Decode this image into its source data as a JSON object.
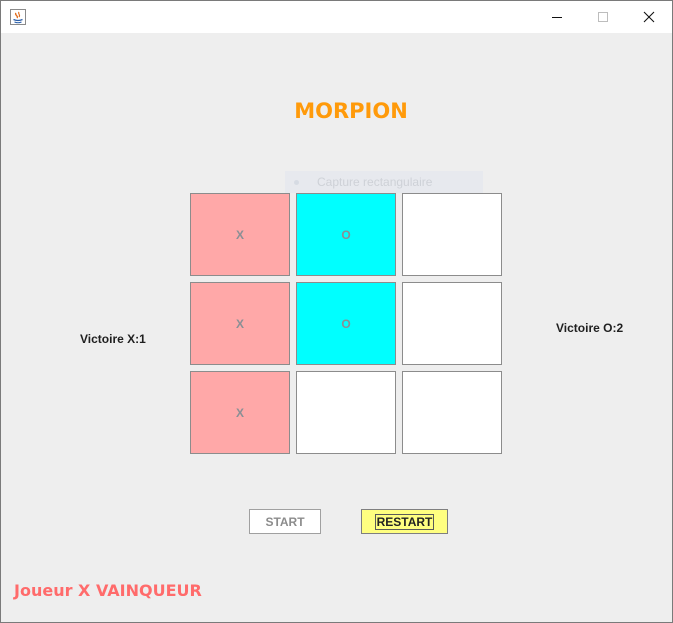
{
  "window": {
    "app_icon": "java-icon",
    "controls": {
      "minimize": "minimize-icon",
      "maximize": "maximize-icon",
      "close": "close-icon"
    }
  },
  "game": {
    "title": "MORPION",
    "board": [
      [
        "X",
        "O",
        ""
      ],
      [
        "X",
        "O",
        ""
      ],
      [
        "X",
        "",
        ""
      ]
    ],
    "colors": {
      "x_cell": "#ffa8a8",
      "o_cell": "#00ffff",
      "empty_cell": "#ffffff"
    },
    "score_x": "Victoire X:1",
    "score_o": "Victoire O:2",
    "start_label": "START",
    "restart_label": "RESTART",
    "status": "Joueur X VAINQUEUR"
  },
  "overlay": {
    "label": "Capture rectangulaire"
  }
}
